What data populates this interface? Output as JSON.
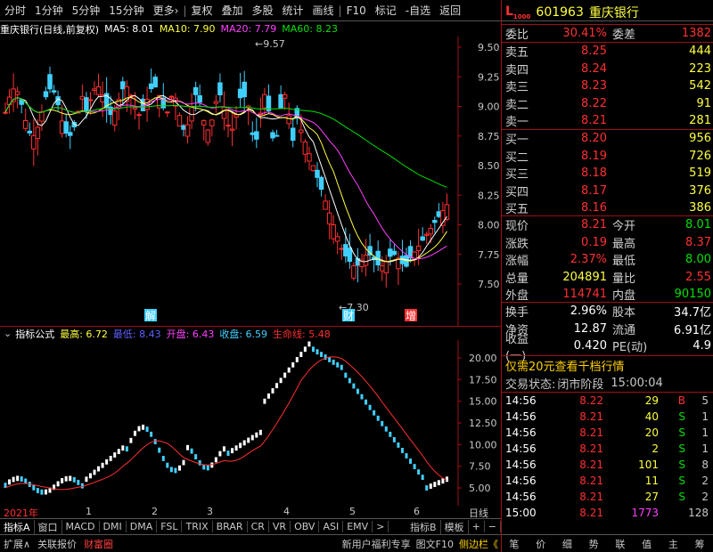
{
  "toolbar": {
    "items": [
      "分时",
      "1分钟",
      "5分钟",
      "15分钟",
      "更多›",
      "复权",
      "叠加",
      "多股",
      "统计",
      "画线",
      "F10",
      "标记",
      "-自选",
      "返回"
    ]
  },
  "title_bar": {
    "stock": "重庆银行(日线,前复权)",
    "ma5": "MA5: 8.01",
    "ma10": "MA10: 7.90",
    "ma20": "MA20: 7.79",
    "ma60": "MA60: 8.23"
  },
  "price_axis": [
    "9.50",
    "9.25",
    "9.00",
    "8.75",
    "8.50",
    "8.25",
    "8.00",
    "7.75",
    "7.50"
  ],
  "price_high_label": "9.57",
  "price_low_label": "7.30",
  "markers": {
    "jie": "解",
    "cai": "财",
    "zeng": "增"
  },
  "indicator": {
    "name": "指标公式",
    "high": "最高: 6.72",
    "low": "最低: 8.43",
    "open": "开盘: 6.43",
    "close": "收盘: 6.59",
    "life": "生命线: 5.48",
    "axis": [
      "20.00",
      "17.50",
      "15.00",
      "12.50",
      "10.00",
      "7.50",
      "5.00"
    ]
  },
  "time_axis": [
    "2021年",
    "1",
    "2",
    "3",
    "4",
    "5",
    "6"
  ],
  "time_axis_right": "日线",
  "indicator_tabs": [
    "指标A",
    "窗口",
    "MACD",
    "DMI",
    "DMA",
    "FSL",
    "TRIX",
    "BRAR",
    "CR",
    "VR",
    "OBV",
    "ASI",
    "EMV",
    ">",
    "指标B",
    "模板",
    "+",
    "−"
  ],
  "bottom_bar": {
    "left": [
      "扩展∧",
      "关联报价",
      "财富圈"
    ],
    "promo": "新用户福利专享",
    "f10": "图文F10",
    "side": "侧边栏《",
    "icons": [
      "笔",
      "价",
      "细",
      "势",
      "联",
      "值",
      "主",
      "筹"
    ]
  },
  "quote": {
    "code": "601963",
    "name": "重庆银行",
    "weibi_label": "委比",
    "weibi": "30.41%",
    "weicha_label": "委差",
    "weicha": "1382",
    "sell": [
      {
        "label": "卖五",
        "price": "8.25",
        "vol": "444"
      },
      {
        "label": "卖四",
        "price": "8.24",
        "vol": "223"
      },
      {
        "label": "卖三",
        "price": "8.23",
        "vol": "542"
      },
      {
        "label": "卖二",
        "price": "8.22",
        "vol": "91"
      },
      {
        "label": "卖一",
        "price": "8.21",
        "vol": "281"
      }
    ],
    "buy": [
      {
        "label": "买一",
        "price": "8.20",
        "vol": "956"
      },
      {
        "label": "买二",
        "price": "8.19",
        "vol": "726"
      },
      {
        "label": "买三",
        "price": "8.18",
        "vol": "519"
      },
      {
        "label": "买四",
        "price": "8.17",
        "vol": "376"
      },
      {
        "label": "买五",
        "price": "8.16",
        "vol": "386"
      }
    ],
    "stats": [
      {
        "l1": "现价",
        "v1": "8.21",
        "c1": "red",
        "l2": "今开",
        "v2": "8.01",
        "c2": "green"
      },
      {
        "l1": "涨跌",
        "v1": "0.19",
        "c1": "red",
        "l2": "最高",
        "v2": "8.37",
        "c2": "red"
      },
      {
        "l1": "涨幅",
        "v1": "2.37%",
        "c1": "red",
        "l2": "最低",
        "v2": "8.00",
        "c2": "green"
      },
      {
        "l1": "总量",
        "v1": "204891",
        "c1": "yellow",
        "l2": "量比",
        "v2": "2.55",
        "c2": "red"
      },
      {
        "l1": "外盘",
        "v1": "114741",
        "c1": "red",
        "l2": "内盘",
        "v2": "90150",
        "c2": "green"
      }
    ],
    "stats2": [
      {
        "l1": "换手",
        "v1": "2.96%",
        "l2": "股本",
        "v2": "34.7亿"
      },
      {
        "l1": "净资",
        "v1": "12.87",
        "l2": "流通",
        "v2": "6.91亿"
      },
      {
        "l1": "收益(一)",
        "v1": "0.420",
        "l2": "PE(动)",
        "v2": "4.9"
      }
    ],
    "promo": "仅需20元查看千档行情",
    "status_label": "交易状态:",
    "status": "闭市阶段",
    "status_time": "15:00:04",
    "ticks": [
      {
        "t": "14:56",
        "p": "8.22",
        "v": "29",
        "bs": "B",
        "n": "5"
      },
      {
        "t": "14:56",
        "p": "8.21",
        "v": "40",
        "bs": "S",
        "n": "1"
      },
      {
        "t": "14:56",
        "p": "8.21",
        "v": "20",
        "bs": "S",
        "n": "1"
      },
      {
        "t": "14:56",
        "p": "8.21",
        "v": "2",
        "bs": "S",
        "n": "1"
      },
      {
        "t": "14:56",
        "p": "8.21",
        "v": "101",
        "bs": "S",
        "n": "8"
      },
      {
        "t": "14:56",
        "p": "8.21",
        "v": "11",
        "bs": "S",
        "n": "2"
      },
      {
        "t": "14:56",
        "p": "8.21",
        "v": "27",
        "bs": "S",
        "n": "2"
      },
      {
        "t": "15:00",
        "p": "8.21",
        "v": "1773",
        "bs": "",
        "n": "128"
      }
    ]
  }
}
